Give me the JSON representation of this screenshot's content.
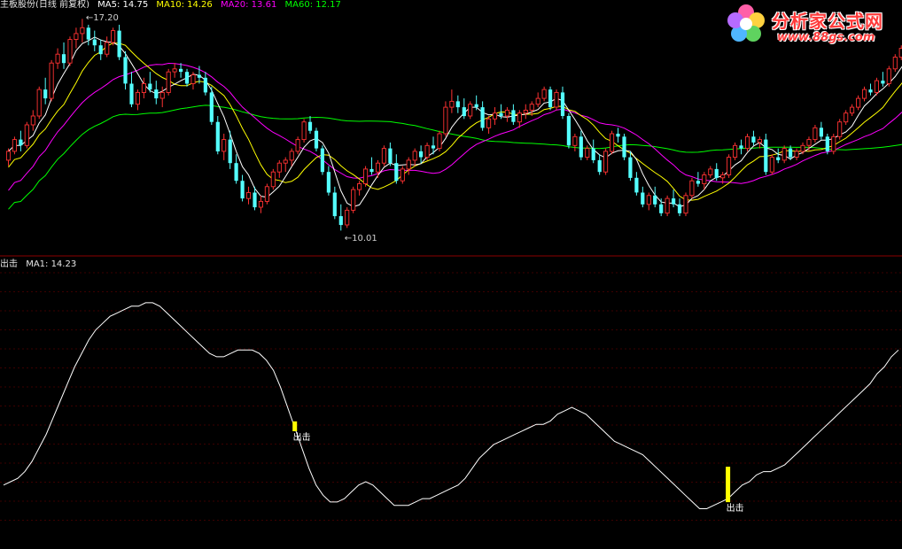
{
  "header": {
    "title": "主板股份(日线 前复权)",
    "ma5_label": "MA5: 14.75",
    "ma10_label": "MA10: 14.26",
    "ma20_label": "MA20: 13.61",
    "ma60_label": "MA60: 12.17",
    "ma5_color": "#ffffff",
    "ma10_color": "#ffff00",
    "ma20_color": "#ff00ff",
    "ma60_color": "#00ff00"
  },
  "indicator_header": {
    "name": "出击",
    "ma1_label": "MA1: 14.23"
  },
  "watermark": {
    "title": "分析家公式网",
    "url": "www.88gs.com"
  },
  "colors": {
    "up": "#ff3232",
    "down": "#54ffff",
    "signal": "#ffff00",
    "grid": "#7a0000",
    "separator": "#8b0000",
    "line": "#ffffff"
  },
  "chart_data": [
    {
      "type": "candlestick",
      "title": "",
      "price_range": [
        9.6,
        17.6
      ],
      "annotations": [
        {
          "label": "17.20",
          "index": 12,
          "value": 17.2
        },
        {
          "label": "10.01",
          "index": 54,
          "value": 10.01
        }
      ],
      "ohlc": [
        [
          12.4,
          12.8,
          12.2,
          12.7
        ],
        [
          12.7,
          13.2,
          12.6,
          13.1
        ],
        [
          13.1,
          13.4,
          12.7,
          12.9
        ],
        [
          12.9,
          13.7,
          12.8,
          13.6
        ],
        [
          13.6,
          14.1,
          13.4,
          13.9
        ],
        [
          13.9,
          14.9,
          13.8,
          14.8
        ],
        [
          14.8,
          15.2,
          14.3,
          14.5
        ],
        [
          14.5,
          15.8,
          14.4,
          15.7
        ],
        [
          15.7,
          16.2,
          15.5,
          16.0
        ],
        [
          16.0,
          16.4,
          15.5,
          15.7
        ],
        [
          15.7,
          16.6,
          15.6,
          16.5
        ],
        [
          16.5,
          16.9,
          16.2,
          16.7
        ],
        [
          16.7,
          17.2,
          16.4,
          16.9
        ],
        [
          16.9,
          17.0,
          16.3,
          16.5
        ],
        [
          16.5,
          16.8,
          16.1,
          16.3
        ],
        [
          16.3,
          16.5,
          15.8,
          16.0
        ],
        [
          16.0,
          16.6,
          15.9,
          16.4
        ],
        [
          16.4,
          16.9,
          16.3,
          16.8
        ],
        [
          16.8,
          17.0,
          15.8,
          15.9
        ],
        [
          15.9,
          16.1,
          14.8,
          15.0
        ],
        [
          15.0,
          15.4,
          14.2,
          14.3
        ],
        [
          14.3,
          14.8,
          14.1,
          14.7
        ],
        [
          14.7,
          15.2,
          14.5,
          15.0
        ],
        [
          15.0,
          15.4,
          14.7,
          14.8
        ],
        [
          14.8,
          15.1,
          14.3,
          14.5
        ],
        [
          14.5,
          14.9,
          14.2,
          14.7
        ],
        [
          14.7,
          15.5,
          14.6,
          15.4
        ],
        [
          15.4,
          15.7,
          15.2,
          15.5
        ],
        [
          15.5,
          15.7,
          15.2,
          15.4
        ],
        [
          15.4,
          15.5,
          14.9,
          15.0
        ],
        [
          15.0,
          15.4,
          14.8,
          15.3
        ],
        [
          15.3,
          15.6,
          15.0,
          15.2
        ],
        [
          15.2,
          15.4,
          14.6,
          14.7
        ],
        [
          14.7,
          14.9,
          13.6,
          13.7
        ],
        [
          13.7,
          13.9,
          12.6,
          12.7
        ],
        [
          12.7,
          13.3,
          12.4,
          13.1
        ],
        [
          13.1,
          13.4,
          12.1,
          12.3
        ],
        [
          12.3,
          12.6,
          11.6,
          11.7
        ],
        [
          11.7,
          11.9,
          11.0,
          11.1
        ],
        [
          11.1,
          11.5,
          10.9,
          11.3
        ],
        [
          11.3,
          11.5,
          10.7,
          10.8
        ],
        [
          10.8,
          11.2,
          10.6,
          11.0
        ],
        [
          11.0,
          11.6,
          10.9,
          11.5
        ],
        [
          11.5,
          12.1,
          11.4,
          12.0
        ],
        [
          12.0,
          12.4,
          11.8,
          12.3
        ],
        [
          12.3,
          12.5,
          12.0,
          12.4
        ],
        [
          12.4,
          12.8,
          12.2,
          12.7
        ],
        [
          12.7,
          13.2,
          12.6,
          13.1
        ],
        [
          13.1,
          13.8,
          13.0,
          13.7
        ],
        [
          13.7,
          13.9,
          13.3,
          13.4
        ],
        [
          13.4,
          13.5,
          12.7,
          12.8
        ],
        [
          12.8,
          12.9,
          11.9,
          12.0
        ],
        [
          12.0,
          12.2,
          11.2,
          11.3
        ],
        [
          11.3,
          11.5,
          10.4,
          10.5
        ],
        [
          10.5,
          10.9,
          10.01,
          10.2
        ],
        [
          10.2,
          10.8,
          10.1,
          10.7
        ],
        [
          10.7,
          11.5,
          10.6,
          11.4
        ],
        [
          11.4,
          11.7,
          11.2,
          11.6
        ],
        [
          11.6,
          12.2,
          11.5,
          12.1
        ],
        [
          12.1,
          12.5,
          11.9,
          12.0
        ],
        [
          12.0,
          12.4,
          11.8,
          12.3
        ],
        [
          12.3,
          12.9,
          12.2,
          12.8
        ],
        [
          12.8,
          13.0,
          12.2,
          12.3
        ],
        [
          12.3,
          12.6,
          11.6,
          11.7
        ],
        [
          11.7,
          12.2,
          11.6,
          12.1
        ],
        [
          12.1,
          12.5,
          11.9,
          12.4
        ],
        [
          12.4,
          12.8,
          12.2,
          12.7
        ],
        [
          12.7,
          12.9,
          12.3,
          12.5
        ],
        [
          12.5,
          13.0,
          12.4,
          12.9
        ],
        [
          12.9,
          13.2,
          12.6,
          12.8
        ],
        [
          12.8,
          13.4,
          12.7,
          13.3
        ],
        [
          13.3,
          14.4,
          13.2,
          14.2
        ],
        [
          14.2,
          14.8,
          14.0,
          14.4
        ],
        [
          14.4,
          14.6,
          14.0,
          14.2
        ],
        [
          14.2,
          14.5,
          13.8,
          13.9
        ],
        [
          13.9,
          14.4,
          13.8,
          14.3
        ],
        [
          14.3,
          14.6,
          14.1,
          14.2
        ],
        [
          14.2,
          14.4,
          13.4,
          13.5
        ],
        [
          13.5,
          13.9,
          13.3,
          13.8
        ],
        [
          13.8,
          14.2,
          13.6,
          14.0
        ],
        [
          14.0,
          14.3,
          13.8,
          13.9
        ],
        [
          13.9,
          14.2,
          13.7,
          14.1
        ],
        [
          14.1,
          14.3,
          13.6,
          13.7
        ],
        [
          13.7,
          14.1,
          13.5,
          14.0
        ],
        [
          14.0,
          14.3,
          13.8,
          14.1
        ],
        [
          14.1,
          14.4,
          13.9,
          14.3
        ],
        [
          14.3,
          14.7,
          14.2,
          14.5
        ],
        [
          14.5,
          14.9,
          14.4,
          14.8
        ],
        [
          14.8,
          14.9,
          14.1,
          14.2
        ],
        [
          14.2,
          14.8,
          14.1,
          14.7
        ],
        [
          14.7,
          14.9,
          13.8,
          13.9
        ],
        [
          13.9,
          14.0,
          12.8,
          12.9
        ],
        [
          12.9,
          13.3,
          12.7,
          13.2
        ],
        [
          13.2,
          13.4,
          12.4,
          12.5
        ],
        [
          12.5,
          12.9,
          12.4,
          12.8
        ],
        [
          12.8,
          13.1,
          12.3,
          12.4
        ],
        [
          12.4,
          12.6,
          11.9,
          12.0
        ],
        [
          12.0,
          12.8,
          11.9,
          12.7
        ],
        [
          12.7,
          13.4,
          12.6,
          13.3
        ],
        [
          13.3,
          13.5,
          13.0,
          13.2
        ],
        [
          13.2,
          13.3,
          12.4,
          12.5
        ],
        [
          12.5,
          12.7,
          11.7,
          11.8
        ],
        [
          11.8,
          12.0,
          11.2,
          11.3
        ],
        [
          11.3,
          11.5,
          10.8,
          10.9
        ],
        [
          10.9,
          11.3,
          10.7,
          11.2
        ],
        [
          11.2,
          11.5,
          10.8,
          10.9
        ],
        [
          10.9,
          11.1,
          10.5,
          10.6
        ],
        [
          10.6,
          11.2,
          10.5,
          11.1
        ],
        [
          11.1,
          11.4,
          10.8,
          10.9
        ],
        [
          10.9,
          11.1,
          10.5,
          10.6
        ],
        [
          10.6,
          11.3,
          10.5,
          11.2
        ],
        [
          11.2,
          11.8,
          11.1,
          11.7
        ],
        [
          11.7,
          12.0,
          11.5,
          11.6
        ],
        [
          11.6,
          12.0,
          11.4,
          11.9
        ],
        [
          11.9,
          12.2,
          11.8,
          12.1
        ],
        [
          12.1,
          12.3,
          11.7,
          11.8
        ],
        [
          11.8,
          12.0,
          11.6,
          11.9
        ],
        [
          11.9,
          12.6,
          11.8,
          12.5
        ],
        [
          12.5,
          13.0,
          12.4,
          12.9
        ],
        [
          12.9,
          13.1,
          12.6,
          12.8
        ],
        [
          12.8,
          13.3,
          12.7,
          13.2
        ],
        [
          13.2,
          13.4,
          12.9,
          13.0
        ],
        [
          13.0,
          13.2,
          12.8,
          13.1
        ],
        [
          13.1,
          13.3,
          11.9,
          12.0
        ],
        [
          12.0,
          12.6,
          11.9,
          12.5
        ],
        [
          12.5,
          12.8,
          12.3,
          12.4
        ],
        [
          12.4,
          12.9,
          12.3,
          12.8
        ],
        [
          12.8,
          12.9,
          12.4,
          12.5
        ],
        [
          12.5,
          12.8,
          12.4,
          12.7
        ],
        [
          12.7,
          13.0,
          12.6,
          12.9
        ],
        [
          12.9,
          13.2,
          12.7,
          13.1
        ],
        [
          13.1,
          13.6,
          13.0,
          13.5
        ],
        [
          13.5,
          13.7,
          13.1,
          13.2
        ],
        [
          13.2,
          13.3,
          12.6,
          12.7
        ],
        [
          12.7,
          13.3,
          12.6,
          13.2
        ],
        [
          13.2,
          13.8,
          13.1,
          13.7
        ],
        [
          13.7,
          14.1,
          13.6,
          14.0
        ],
        [
          14.0,
          14.3,
          13.9,
          14.2
        ],
        [
          14.2,
          14.6,
          14.1,
          14.5
        ],
        [
          14.5,
          14.9,
          14.4,
          14.8
        ],
        [
          14.8,
          15.0,
          14.6,
          14.7
        ],
        [
          14.7,
          15.2,
          14.6,
          15.1
        ],
        [
          15.1,
          15.4,
          14.9,
          15.0
        ],
        [
          15.0,
          15.6,
          14.9,
          15.5
        ],
        [
          15.5,
          16.0,
          15.4,
          15.9
        ],
        [
          15.9,
          16.3,
          15.8,
          16.2
        ],
        [
          16.2,
          16.7,
          16.0,
          16.6
        ],
        [
          16.6,
          17.2,
          16.5,
          17.0
        ]
      ]
    },
    {
      "type": "line",
      "title": "",
      "series": [
        {
          "name": "MA1",
          "y_range": [
            9.6,
            17.6
          ],
          "values": [
            11.1,
            11.2,
            11.3,
            11.5,
            11.8,
            12.2,
            12.6,
            13.1,
            13.6,
            14.1,
            14.6,
            15.0,
            15.4,
            15.7,
            15.9,
            16.1,
            16.2,
            16.3,
            16.4,
            16.4,
            16.5,
            16.5,
            16.4,
            16.2,
            16.0,
            15.8,
            15.6,
            15.4,
            15.2,
            15.0,
            14.9,
            14.9,
            15.0,
            15.1,
            15.1,
            15.1,
            15.0,
            14.8,
            14.5,
            14.0,
            13.4,
            12.8,
            12.2,
            11.6,
            11.1,
            10.8,
            10.6,
            10.6,
            10.7,
            10.9,
            11.1,
            11.2,
            11.1,
            10.9,
            10.7,
            10.5,
            10.5,
            10.5,
            10.6,
            10.7,
            10.7,
            10.8,
            10.9,
            11.0,
            11.1,
            11.3,
            11.6,
            11.9,
            12.1,
            12.3,
            12.4,
            12.5,
            12.6,
            12.7,
            12.8,
            12.9,
            12.9,
            13.0,
            13.2,
            13.3,
            13.4,
            13.3,
            13.2,
            13.0,
            12.8,
            12.6,
            12.4,
            12.3,
            12.2,
            12.1,
            12.0,
            11.8,
            11.6,
            11.4,
            11.2,
            11.0,
            10.8,
            10.6,
            10.4,
            10.4,
            10.5,
            10.6,
            10.7,
            10.9,
            11.1,
            11.2,
            11.4,
            11.5,
            11.5,
            11.6,
            11.7,
            11.9,
            12.1,
            12.3,
            12.5,
            12.7,
            12.9,
            13.1,
            13.3,
            13.5,
            13.7,
            13.9,
            14.1,
            14.4,
            14.6,
            14.9,
            15.1
          ]
        }
      ],
      "signals": [
        {
          "label": "出击",
          "index": 41,
          "height": 0.15
        },
        {
          "label": "出击",
          "index": 102,
          "height": 1.0
        }
      ]
    }
  ]
}
